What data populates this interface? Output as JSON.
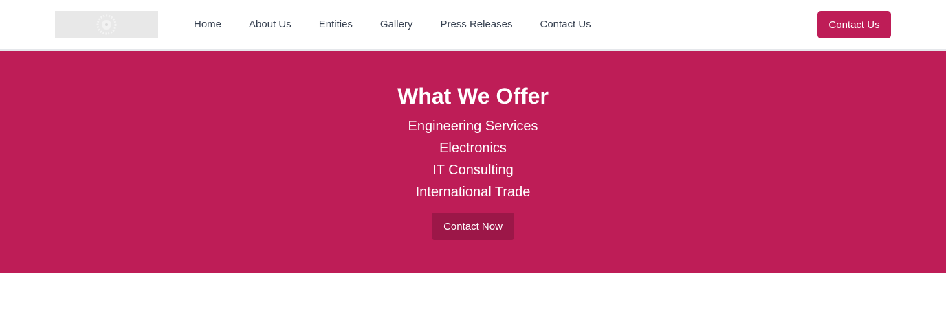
{
  "header": {
    "nav": [
      {
        "label": "Home"
      },
      {
        "label": "About Us"
      },
      {
        "label": "Entities"
      },
      {
        "label": "Gallery"
      },
      {
        "label": "Press Releases"
      },
      {
        "label": "Contact Us"
      }
    ],
    "cta_label": "Contact Us"
  },
  "hero": {
    "title": "What We Offer",
    "services": [
      "Engineering Services",
      "Electronics",
      "IT Consulting",
      "International Trade"
    ],
    "cta_label": "Contact Now"
  },
  "colors": {
    "brand": "#be1d57",
    "brand_dark": "#9c1748",
    "nav_text": "#374151",
    "logo_placeholder": "#e8e8e8"
  },
  "icons": {
    "logo": "logo-placeholder-icon"
  }
}
